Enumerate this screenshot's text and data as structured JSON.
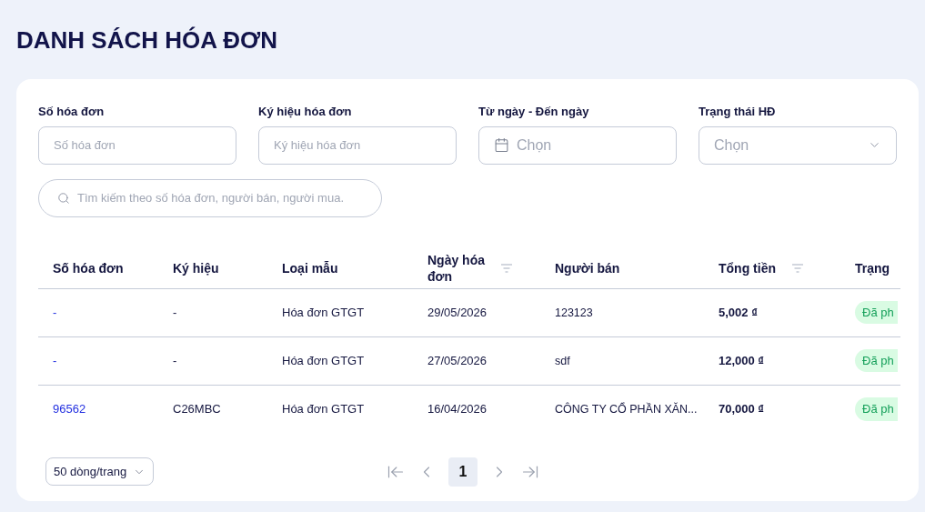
{
  "title": "DANH SÁCH HÓA ĐƠN",
  "filters": [
    {
      "kind": "text",
      "label": "Số hóa đơn",
      "placeholder": "Số hóa đơn"
    },
    {
      "kind": "text",
      "label": "Ký hiệu hóa đơn",
      "placeholder": "Ký hiệu hóa đơn"
    },
    {
      "kind": "date",
      "label": "Từ ngày - Đến ngày",
      "placeholder": "Chọn"
    },
    {
      "kind": "select",
      "label": "Trạng thái HĐ",
      "placeholder": "Chọn"
    }
  ],
  "search": {
    "placeholder": "Tìm kiếm theo số hóa đơn, người bán, người mua."
  },
  "table": {
    "columns": [
      {
        "label": "Số hóa đơn",
        "filter": false
      },
      {
        "label": "Ký hiệu",
        "filter": false
      },
      {
        "label": "Loại mẫu",
        "filter": false
      },
      {
        "label": "Ngày hóa đơn",
        "filter": true
      },
      {
        "label": "Người bán",
        "filter": false
      },
      {
        "label": "Tổng tiền",
        "filter": true
      },
      {
        "label": "Trạng",
        "filter": false
      }
    ],
    "rows": [
      {
        "number": "-",
        "symbol": "-",
        "type": "Hóa đơn GTGT",
        "date": "29/05/2026",
        "seller": "123123",
        "total": "5,002 ₫",
        "status": "Đã ph"
      },
      {
        "number": "-",
        "symbol": "-",
        "type": "Hóa đơn GTGT",
        "date": "27/05/2026",
        "seller": "sdf",
        "total": "12,000 ₫",
        "status": "Đã ph"
      },
      {
        "number": "96562",
        "symbol": "C26MBC",
        "type": "Hóa đơn GTGT",
        "date": "16/04/2026",
        "seller": "CÔNG TY CỔ PHẦN XĂN...",
        "total": "70,000 ₫",
        "status": "Đã ph"
      }
    ]
  },
  "pagination": {
    "page_size": "50 dòng/trang",
    "pages": [
      {
        "label": "1",
        "selected": true
      }
    ]
  }
}
